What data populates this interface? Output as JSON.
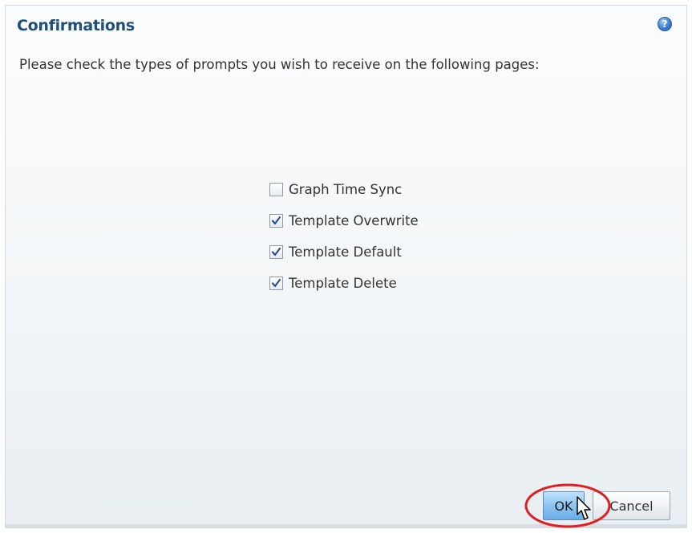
{
  "dialog": {
    "title": "Confirmations",
    "help_icon_glyph": "?",
    "instructions": "Please check the types of prompts you wish to receive on the following pages:"
  },
  "options": [
    {
      "label": "Graph Time Sync",
      "checked": false
    },
    {
      "label": "Template Overwrite",
      "checked": true
    },
    {
      "label": "Template Default",
      "checked": true
    },
    {
      "label": "Template Delete",
      "checked": true
    }
  ],
  "buttons": {
    "ok_label": "OK",
    "cancel_label": "Cancel"
  },
  "icons": {
    "help": "help-icon",
    "cursor": "mouse-cursor-icon",
    "checkmark": "checkmark-icon"
  },
  "colors": {
    "title": "#1f4e79",
    "ok_button": "#8cc4f0",
    "annotation": "#e02020",
    "checkmark": "#2b4f9a"
  }
}
